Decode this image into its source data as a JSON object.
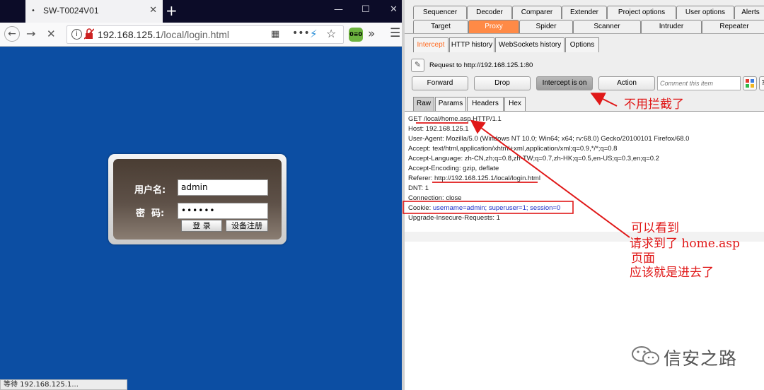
{
  "firefox": {
    "tab_bullet": "•",
    "tab_title": "SW-T0024V01",
    "tab_close": "✕",
    "new_tab": "+",
    "win_minimize": "—",
    "win_maximize": "☐",
    "win_close": "✕",
    "back": "←",
    "forward": "→",
    "stop": "✕",
    "url_info": "i",
    "url_lock": "🔒",
    "url_host": "192.168.125.1",
    "url_path": "/local/login.html",
    "qr_icon": "▦",
    "more_actions": "•••",
    "bolt_icon": "⚡",
    "bookmark_star": "☆",
    "extension_badge": "0≡0",
    "overflow": "»",
    "menu": "☰",
    "status_text": "等待 192.168.125.1..."
  },
  "login": {
    "username_label": "用户名:",
    "username_value": "admin",
    "password_label": "密  码:",
    "password_value": "••••••",
    "login_button": "登 录",
    "register_button": "设备注册"
  },
  "burp": {
    "main_tabs_row1": [
      "Sequencer",
      "Decoder",
      "Comparer",
      "Extender",
      "Project options",
      "User options",
      "Alerts"
    ],
    "main_tabs_row2": [
      "Target",
      "Proxy",
      "Spider",
      "Scanner",
      "Intruder",
      "Repeater"
    ],
    "active_main_tab": "Proxy",
    "proxy_tabs": [
      "Intercept",
      "HTTP history",
      "WebSockets history",
      "Options"
    ],
    "active_proxy_tab": "Intercept",
    "request_to": "Request to http://192.168.125.1:80",
    "buttons": {
      "forward": "Forward",
      "drop": "Drop",
      "intercept": "Intercept is on",
      "action": "Action"
    },
    "comment_placeholder": "Comment this item",
    "help_icon": "?",
    "message_tabs": [
      "Raw",
      "Params",
      "Headers",
      "Hex"
    ],
    "active_message_tab": "Raw",
    "request_lines": {
      "l1": "GET /local/home.asp HTTP/1.1",
      "l2": "Host: 192.168.125.1",
      "l3": "User-Agent: Mozilla/5.0 (Windows NT 10.0; Win64; x64; rv:68.0) Gecko/20100101 Firefox/68.0",
      "l4": "Accept: text/html,application/xhtml+xml,application/xml;q=0.9,*/*;q=0.8",
      "l5": "Accept-Language: zh-CN,zh;q=0.8,zh-TW;q=0.7,zh-HK;q=0.5,en-US;q=0.3,en;q=0.2",
      "l6": "Accept-Encoding: gzip, deflate",
      "l7": "Referer: http://192.168.125.1/local/login.html",
      "l8": "DNT: 1",
      "l9": "Connection: close",
      "cookie_prefix": "Cookie: ",
      "cookie_username": "username=admin;",
      "cookie_superuser": "superuser=1;",
      "cookie_session": "session=0",
      "l11": "Upgrade-Insecure-Requests: 1"
    }
  },
  "annotations": {
    "no_intercept": "不用拦截了",
    "note_line1": "可以看到",
    "note_line2": "请求到了 home.asp",
    "note_line3": "页面",
    "note_line4": "应该就是进去了"
  },
  "watermark": {
    "text": "信安之路",
    "icon": "wechat-icon"
  },
  "colors": {
    "firefox_page_bg": "#0c4ea3",
    "proxy_tab_active": "#ff8a46",
    "annotation_red": "#e01818",
    "cookie_value_blue": "#1a2ec8"
  }
}
